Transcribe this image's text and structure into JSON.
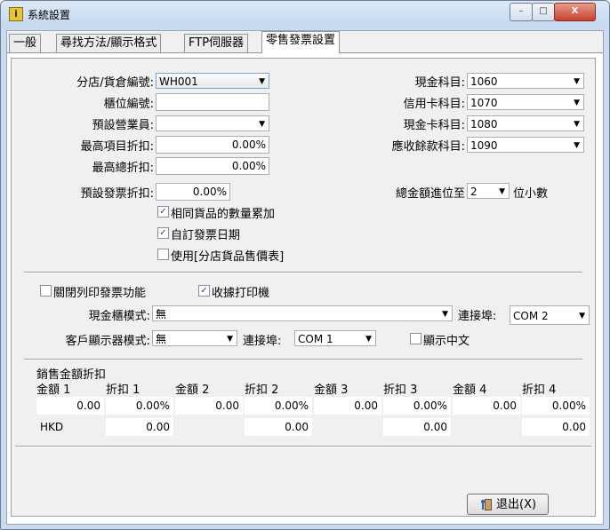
{
  "window": {
    "title": "系統設置",
    "icon": "app-settings-icon",
    "caption_min": "–",
    "caption_max": "□",
    "caption_close": "X"
  },
  "tabs": [
    "一般",
    "尋找方法/顯示格式",
    "FTP伺服器",
    "零售發票設置"
  ],
  "active_tab": "零售發票設置",
  "left_form": {
    "branch_label": "分店/貨倉編號:",
    "branch_value": "WH001",
    "counter_label": "櫃位編號:",
    "counter_value": "",
    "salesperson_label": "預設營業員:",
    "salesperson_value": "",
    "max_item_disc_label": "最高項目折扣:",
    "max_item_disc_value": "0.00%",
    "max_total_disc_label": "最高總折扣:",
    "max_total_disc_value": "0.00%",
    "default_inv_disc_label": "預設發票折扣:",
    "default_inv_disc_value": "0.00%"
  },
  "right_form": {
    "cash_acc_label": "現金科目:",
    "cash_acc_value": "1060",
    "credit_acc_label": "信用卡科目:",
    "credit_acc_value": "1070",
    "cash2_acc_label": "現金卡科目:",
    "cash2_acc_value": "1080",
    "ar_acc_label": "應收餘款科目:",
    "ar_acc_value": "1090",
    "rounding_label": "總金額進位至",
    "rounding_value": "2",
    "rounding_suffix": "位小數"
  },
  "checkboxes": {
    "accumulate_qty": {
      "label": "相同貨品的數量累加",
      "checked": true,
      "mark": "✓"
    },
    "custom_inv_date": {
      "label": "自訂發票日期",
      "checked": true,
      "mark": "✓"
    },
    "use_branch_price": {
      "label": "使用[分店貨品售價表]",
      "checked": false,
      "mark": ""
    },
    "disable_print": {
      "label": "關閉列印發票功能",
      "checked": false,
      "mark": ""
    },
    "receipt_printer": {
      "label": "收據打印機",
      "checked": true,
      "mark": "✓"
    },
    "show_chinese": {
      "label": "顯示中文",
      "checked": false,
      "mark": ""
    }
  },
  "devices": {
    "cash_drawer_label": "現金櫃模式:",
    "cash_drawer_value": "無",
    "cash_drawer_port_label": "連接埠:",
    "cash_drawer_port_value": "COM 2",
    "display_label": "客戶顯示器模式:",
    "display_value": "無",
    "display_port_label": "連接埠:",
    "display_port_value": "COM 1"
  },
  "discount_table": {
    "title": "銷售金額折扣",
    "headers": [
      "金額 1",
      "折扣 1",
      "金額 2",
      "折扣 2",
      "金額 3",
      "折扣 3",
      "金額 4",
      "折扣 4"
    ],
    "row1": [
      "0.00",
      "0.00%",
      "0.00",
      "0.00%",
      "0.00",
      "0.00%",
      "0.00",
      "0.00%"
    ],
    "row2": [
      "HKD",
      "0.00",
      "",
      "0.00",
      "",
      "0.00",
      "",
      "0.00"
    ]
  },
  "exit_button": {
    "label": "退出(X)",
    "icon": "exit-door-icon"
  },
  "colors": {
    "titlebar": "#c9dbf0",
    "close_button": "#c7422d",
    "checkbox_mark": "#1b4b8f"
  }
}
